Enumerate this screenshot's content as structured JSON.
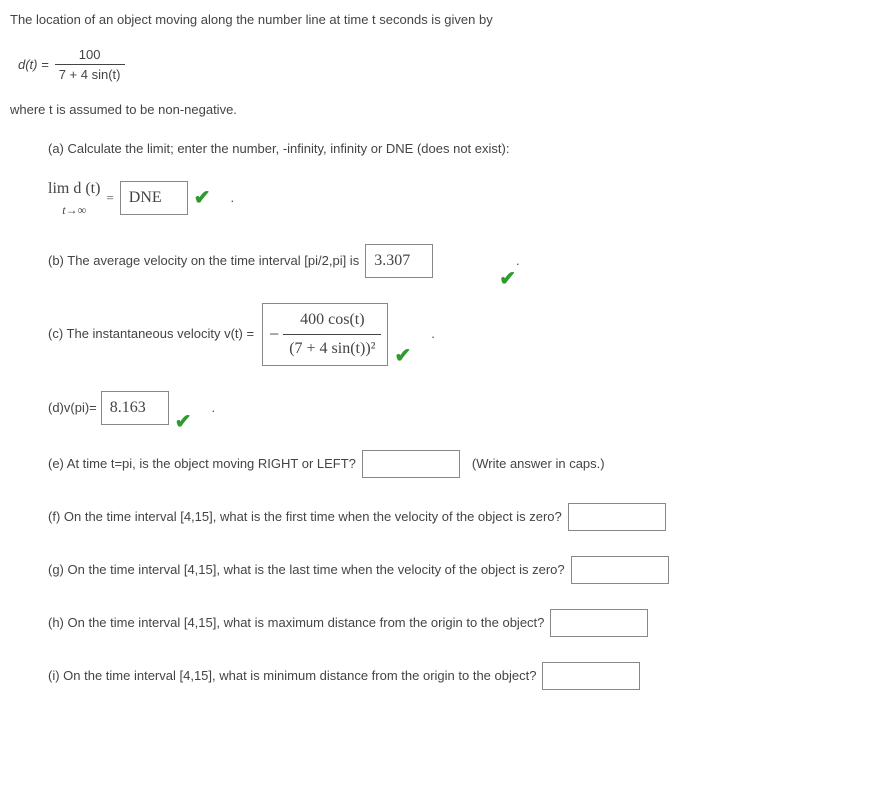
{
  "intro": "The location of an object moving along the number line at time t seconds is given by",
  "formula": {
    "lhs": "d(t) =",
    "num": "100",
    "den": "7 + 4 sin(t)"
  },
  "assume": "where t is assumed to be non-negative.",
  "partA": {
    "text": "(a) Calculate the limit; enter the number, -infinity, infinity or DNE (does not exist):",
    "lim_top": "lim d (t)",
    "lim_bot": "t→∞",
    "equals": "=",
    "answer": "DNE"
  },
  "partB": {
    "text": "(b) The average velocity on the time interval [pi/2,pi] is",
    "answer": "3.307"
  },
  "partC": {
    "text": "(c) The instantaneous velocity v(t) =",
    "minus": "−",
    "num": "400 cos(t)",
    "den": "(7 + 4 sin(t))²"
  },
  "partD": {
    "text": "(d)v(pi)=",
    "answer": "8.163"
  },
  "partE": {
    "text": "(e) At time t=pi, is the object moving RIGHT or LEFT?",
    "after": "(Write answer in caps.)"
  },
  "partF": {
    "text": "(f) On the time interval [4,15], what is the first time when the velocity of the object is zero?"
  },
  "partG": {
    "text": "(g) On the time interval [4,15], what is the last time when the velocity of the object is zero?"
  },
  "partH": {
    "text": "(h) On the time interval [4,15], what is maximum distance from the origin to the object?"
  },
  "partI": {
    "text": "(i) On the time interval [4,15], what is minimum distance from the origin to the object?"
  },
  "chart_data": {
    "type": "table",
    "function": "d(t) = 100 / (7 + 4 sin(t))",
    "domain": "t >= 0",
    "answers": {
      "a_limit_as_t_to_infinity": "DNE",
      "b_avg_velocity_on_[pi/2,pi]": 3.307,
      "c_instantaneous_velocity": "-400 cos(t) / (7 + 4 sin(t))^2",
      "d_v_at_pi": 8.163,
      "e_direction_at_pi": "",
      "f_first_zero_velocity_on_[4,15]": "",
      "g_last_zero_velocity_on_[4,15]": "",
      "h_max_distance_on_[4,15]": "",
      "i_min_distance_on_[4,15]": ""
    }
  }
}
